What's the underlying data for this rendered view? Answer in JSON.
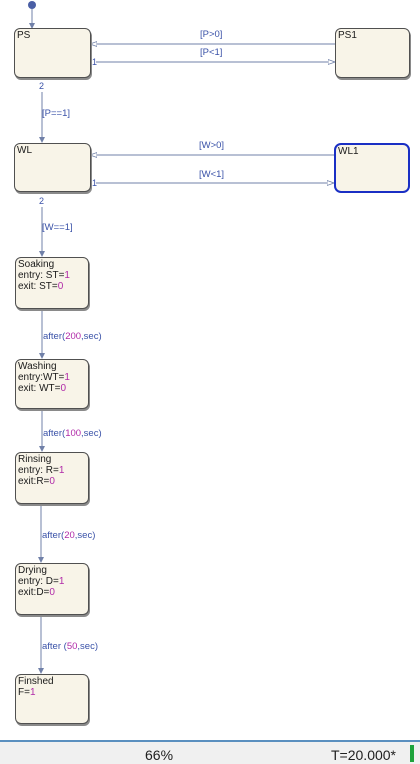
{
  "states": {
    "ps": {
      "name": "PS"
    },
    "ps1": {
      "name": "PS1"
    },
    "wl": {
      "name": "WL"
    },
    "wl1": {
      "name": "WL1"
    },
    "soaking": {
      "name": "Soaking",
      "entry": "entry: ST=",
      "entry_val": "1",
      "exit": "exit: ST=",
      "exit_val": "0"
    },
    "washing": {
      "name": "Washing",
      "entry": "entry:WT=",
      "entry_val": "1",
      "exit": "exit: WT=",
      "exit_val": "0"
    },
    "rinsing": {
      "name": "Rinsing",
      "entry": "entry: R=",
      "entry_val": "1",
      "exit": "exit:R=",
      "exit_val": "0"
    },
    "drying": {
      "name": "Drying",
      "entry": "entry: D=",
      "entry_val": "1",
      "exit": "exit:D=",
      "exit_val": "0"
    },
    "finished": {
      "name": "Finshed",
      "entry": "F=",
      "entry_val": "1"
    }
  },
  "transitions": {
    "ps_to_ps1": "[P>0]",
    "ps1_to_ps": "[P<1]",
    "ps_to_wl": "[P==1]",
    "wl_to_wl1": "[W>0]",
    "wl1_to_wl": "[W<1]",
    "wl_to_soaking": "[W==1]",
    "soak_to_wash": {
      "pre": "after(",
      "num": "200",
      "post": ",sec)"
    },
    "wash_to_rinse": {
      "pre": "after(",
      "num": "100",
      "post": ",sec)"
    },
    "rinse_to_dry": {
      "pre": "after(",
      "num": "20",
      "post": ",sec)"
    },
    "dry_to_finish": {
      "pre": "after (",
      "num": "50",
      "post": ",sec)"
    }
  },
  "priorities": {
    "p1": "1",
    "p2": "2",
    "p3": "1",
    "p4": "2"
  },
  "status": {
    "zoom": "66%",
    "time": "T=20.000*"
  },
  "colors": {
    "active_state": "#1a2fc4",
    "transition": "#3a52a8",
    "constant": "#b02aa8",
    "progress": "#1ea33c"
  }
}
